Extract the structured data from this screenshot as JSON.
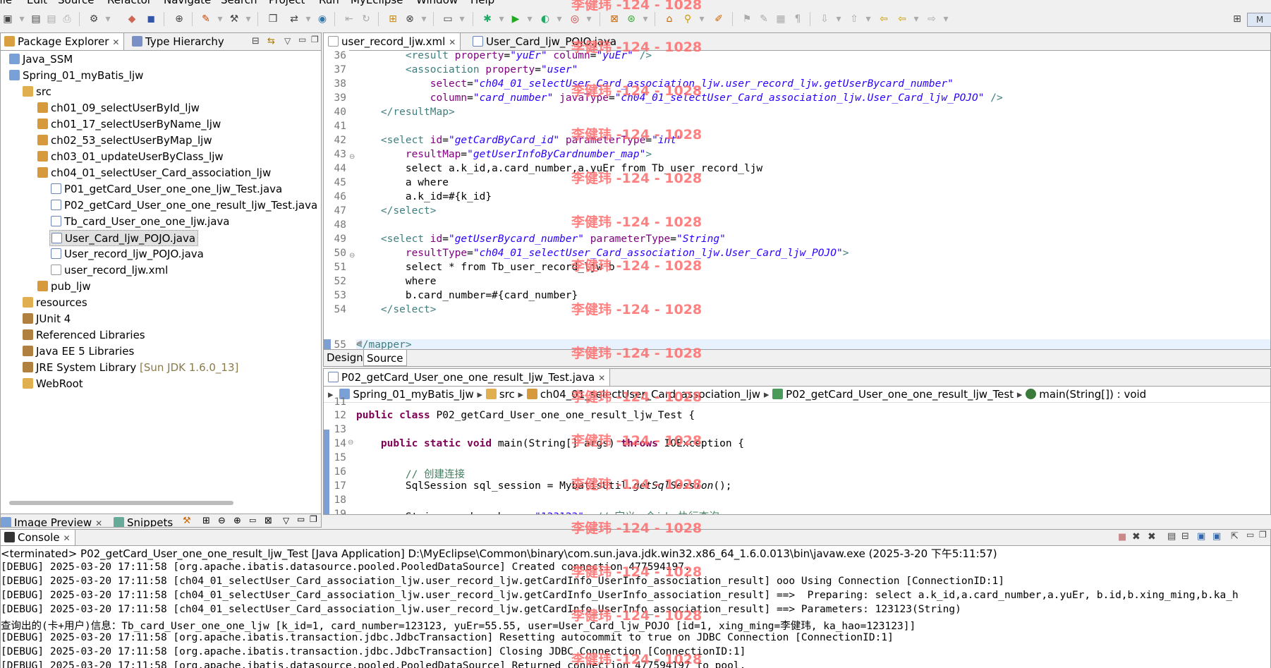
{
  "menu": [
    "File",
    "Edit",
    "Source",
    "Refactor",
    "Navigate",
    "Search",
    "Project",
    "Run",
    "MyEclipse",
    "Window",
    "Help"
  ],
  "explorer": {
    "tabs": [
      "Package Explorer",
      "Type Hierarchy"
    ],
    "tree": [
      {
        "label": "Java_SSM",
        "icon": "project-icon"
      },
      {
        "label": "Spring_01_myBatis_ljw",
        "icon": "project-icon"
      },
      {
        "label": "src",
        "icon": "source-folder-icon"
      },
      {
        "label": "ch01_09_selectUserById_ljw",
        "icon": "package-icon"
      },
      {
        "label": "ch01_17_selectUserByName_ljw",
        "icon": "package-icon"
      },
      {
        "label": "ch02_53_selectUserByMap_ljw",
        "icon": "package-icon"
      },
      {
        "label": "ch03_01_updateUserByClass_ljw",
        "icon": "package-icon"
      },
      {
        "label": "ch04_01_selectUser_Card_association_ljw",
        "icon": "package-icon"
      },
      {
        "label": "P01_getCard_User_one_one_ljw_Test.java",
        "icon": "java-file-icon"
      },
      {
        "label": "P02_getCard_User_one_one_result_ljw_Test.java",
        "icon": "java-file-icon"
      },
      {
        "label": "Tb_card_User_one_one_ljw.java",
        "icon": "java-file-icon"
      },
      {
        "label": "User_Card_ljw_POJO.java",
        "icon": "java-file-icon"
      },
      {
        "label": "User_record_ljw_POJO.java",
        "icon": "java-file-icon"
      },
      {
        "label": "user_record_ljw.xml",
        "icon": "xml-file-icon"
      },
      {
        "label": "pub_ljw",
        "icon": "package-icon"
      },
      {
        "label": "resources",
        "icon": "folder-icon"
      },
      {
        "label": "JUnit 4",
        "icon": "library-icon"
      },
      {
        "label": "Referenced Libraries",
        "icon": "library-icon"
      },
      {
        "label": "Java EE 5 Libraries",
        "icon": "library-icon"
      },
      {
        "label": "JRE System Library",
        "suffix": "[Sun JDK 1.6.0_13]",
        "icon": "library-icon"
      },
      {
        "label": "WebRoot",
        "icon": "folder-icon"
      }
    ],
    "bottom_tabs": [
      "Image Preview",
      "Snippets"
    ]
  },
  "xml_editor": {
    "tabs": [
      "user_record_ljw.xml",
      "User_Card_ljw_POJO.java"
    ],
    "line_numbers": [
      "36",
      "37",
      "38",
      "39",
      "40",
      "41",
      "42",
      "43",
      "44",
      "45",
      "46",
      "47",
      "48",
      "49",
      "50",
      "51",
      "52",
      "53",
      "54",
      "55"
    ],
    "bottom_tabs": [
      "Design",
      "Source"
    ]
  },
  "java_editor": {
    "tab": "P02_getCard_User_one_one_result_ljw_Test.java",
    "breadcrumb": [
      "Spring_01_myBatis_ljw",
      "src",
      "ch04_01_selectUser_Card_association_ljw",
      "P02_getCard_User_one_one_result_ljw_Test",
      "main(String[]) : void"
    ],
    "line_numbers": [
      "11",
      "12",
      "13",
      "14",
      "15",
      "16",
      "17",
      "18",
      "19"
    ]
  },
  "console": {
    "tab": "Console",
    "header": "<terminated> P02_getCard_User_one_one_result_ljw_Test [Java Application] D:\\MyEclipse\\Common\\binary\\com.sun.java.jdk.win32.x86_64_1.6.0.013\\bin\\javaw.exe (2025-3-20 下午5:11:57)",
    "lines": [
      "[DEBUG] 2025-03-20 17:11:58 [org.apache.ibatis.datasource.pooled.PooledDataSource] Created connection 477594197.",
      "[DEBUG] 2025-03-20 17:11:58 [ch04_01_selectUser_Card_association_ljw.user_record_ljw.getCardInfo_UserInfo_association_result] ooo Using Connection [ConnectionID:1]",
      "[DEBUG] 2025-03-20 17:11:58 [ch04_01_selectUser_Card_association_ljw.user_record_ljw.getCardInfo_UserInfo_association_result] ==>  Preparing: select a.k_id,a.card_number,a.yuEr, b.id,b.xing_ming,b.ka_h",
      "[DEBUG] 2025-03-20 17:11:58 [ch04_01_selectUser_Card_association_ljw.user_record_ljw.getCardInfo_UserInfo_association_result] ==> Parameters: 123123(String)",
      "查询出的(卡+用户)信息：Tb_card_User_one_one_ljw [k_id=1, card_number=123123, yuEr=55.55, user=User_Card_ljw_POJO [id=1, xing_ming=李健玮, ka_hao=123123]]",
      "[DEBUG] 2025-03-20 17:11:58 [org.apache.ibatis.transaction.jdbc.JdbcTransaction] Resetting autocommit to true on JDBC Connection [ConnectionID:1]",
      "[DEBUG] 2025-03-20 17:11:58 [org.apache.ibatis.transaction.jdbc.JdbcTransaction] Closing JDBC Connection [ConnectionID:1]",
      "[DEBUG] 2025-03-20 17:11:58 [org.apache.ibatis.datasource.pooled.PooledDataSource] Returned connection 477594197 to pool."
    ]
  },
  "watermark": "李健玮 -124 - 1028",
  "colors": {
    "tag": "#3f7f7f",
    "attr": "#7f007f",
    "value": "#2a00ff",
    "keyword": "#7f0055",
    "comment": "#3f7f5f",
    "watermark": "#ff6b6b"
  }
}
